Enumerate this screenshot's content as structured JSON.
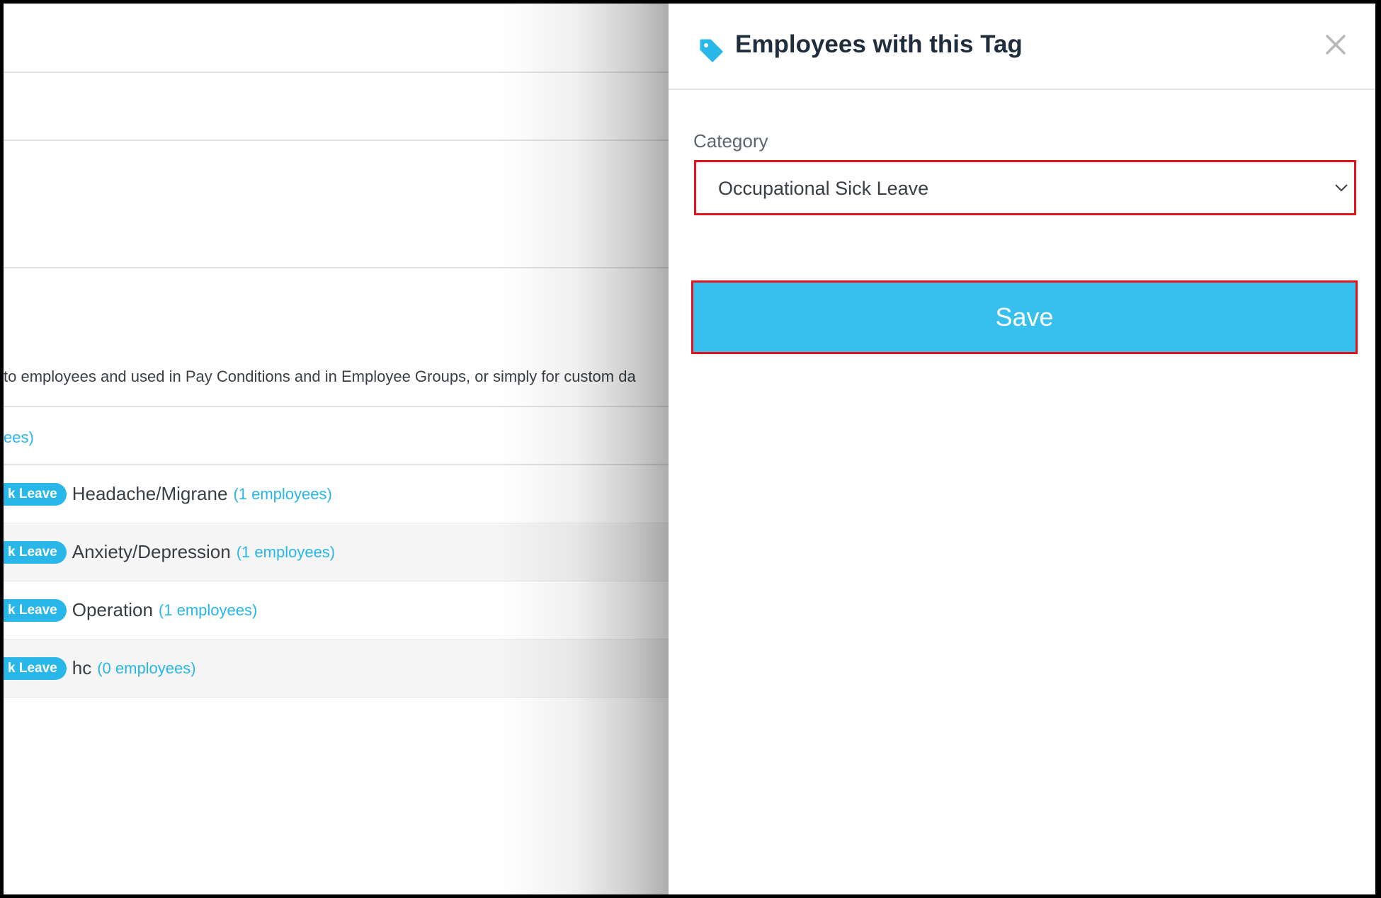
{
  "background_page": {
    "description": "to employees and used in Pay Conditions and in Employee Groups, or simply for custom da",
    "link_fragment": "ees)",
    "tags": [
      {
        "badge": "k Leave",
        "name": "Headache/Migrane",
        "count": "(1 employees)"
      },
      {
        "badge": "k Leave",
        "name": "Anxiety/Depression",
        "count": "(1 employees)"
      },
      {
        "badge": "k Leave",
        "name": "Operation",
        "count": "(1 employees)"
      },
      {
        "badge": "k Leave",
        "name": "hc",
        "count": "(0 employees)"
      }
    ]
  },
  "panel": {
    "title": "Employees with this Tag",
    "close_icon": "close-icon",
    "tag_icon": "tag-icon",
    "category_label": "Category",
    "category_value": "Occupational Sick Leave",
    "save_label": "Save"
  },
  "colors": {
    "accent": "#29b6e8",
    "save_button": "#37bfed",
    "highlight_border": "#e5131b",
    "title_text": "#1f2d3d"
  }
}
